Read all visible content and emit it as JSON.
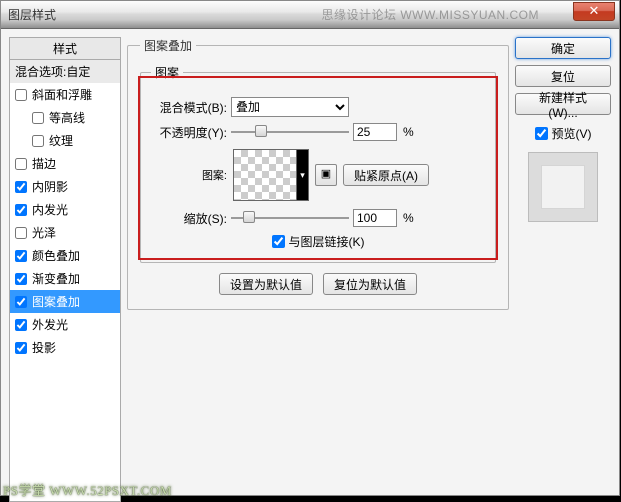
{
  "window": {
    "title": "图层样式",
    "watermark_top": "思缘设计论坛  WWW.MISSYUAN.COM",
    "close_glyph": "✕"
  },
  "left": {
    "header": "样式",
    "blending_label": "混合选项:自定",
    "effects": [
      {
        "label": "斜面和浮雕",
        "checked": false
      },
      {
        "label": "等高线",
        "checked": false,
        "indent": true
      },
      {
        "label": "纹理",
        "checked": false,
        "indent": true
      },
      {
        "label": "描边",
        "checked": false
      },
      {
        "label": "内阴影",
        "checked": true
      },
      {
        "label": "内发光",
        "checked": true
      },
      {
        "label": "光泽",
        "checked": false
      },
      {
        "label": "颜色叠加",
        "checked": true
      },
      {
        "label": "渐变叠加",
        "checked": true
      },
      {
        "label": "图案叠加",
        "checked": true,
        "selected": true
      },
      {
        "label": "外发光",
        "checked": true
      },
      {
        "label": "投影",
        "checked": true
      }
    ]
  },
  "center": {
    "group_title": "图案叠加",
    "inner_title": "图案",
    "blend_mode_label": "混合模式(B):",
    "blend_mode_value": "叠加",
    "opacity_label": "不透明度(Y):",
    "opacity_value": "25",
    "opacity_thumb_pct": 25,
    "pattern_label": "图案:",
    "snap_origin_label": "贴紧原点(A)",
    "scale_label": "缩放(S):",
    "scale_value": "100",
    "scale_thumb_pct": 15,
    "link_label": "与图层链接(K)",
    "link_checked": true,
    "make_default": "设置为默认值",
    "reset_default": "复位为默认值",
    "percent": "%"
  },
  "right": {
    "ok": "确定",
    "cancel": "复位",
    "new_style": "新建样式(W)...",
    "preview_label": "预览(V)",
    "preview_checked": true
  },
  "watermark_bottom": "PS学堂  WWW.52PSXT.COM"
}
